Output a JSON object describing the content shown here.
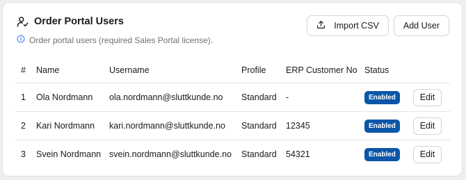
{
  "header": {
    "title": "Order Portal Users",
    "subtitle": "Order portal users (required Sales Portal license).",
    "icon": "user-check-icon",
    "info_icon": "info-icon"
  },
  "actions": {
    "import_label": "Import CSV",
    "import_icon": "upload-icon",
    "add_label": "Add User"
  },
  "table": {
    "columns": [
      "#",
      "Name",
      "Username",
      "Profile",
      "ERP Customer No",
      "Status"
    ],
    "rows": [
      {
        "num": "1",
        "name": "Ola Nordmann",
        "username": "ola.nordmann@sluttkunde.no",
        "profile": "Standard",
        "erp": "-",
        "status": "Enabled",
        "edit": "Edit"
      },
      {
        "num": "2",
        "name": "Kari Nordmann",
        "username": "kari.nordmann@sluttkunde.no",
        "profile": "Standard",
        "erp": "12345",
        "status": "Enabled",
        "edit": "Edit"
      },
      {
        "num": "3",
        "name": "Svein Nordmann",
        "username": "svein.nordmann@sluttkunde.no",
        "profile": "Standard",
        "erp": "54321",
        "status": "Enabled",
        "edit": "Edit"
      }
    ]
  },
  "colors": {
    "badge": "#0b56a8",
    "info": "#3b82f6"
  }
}
